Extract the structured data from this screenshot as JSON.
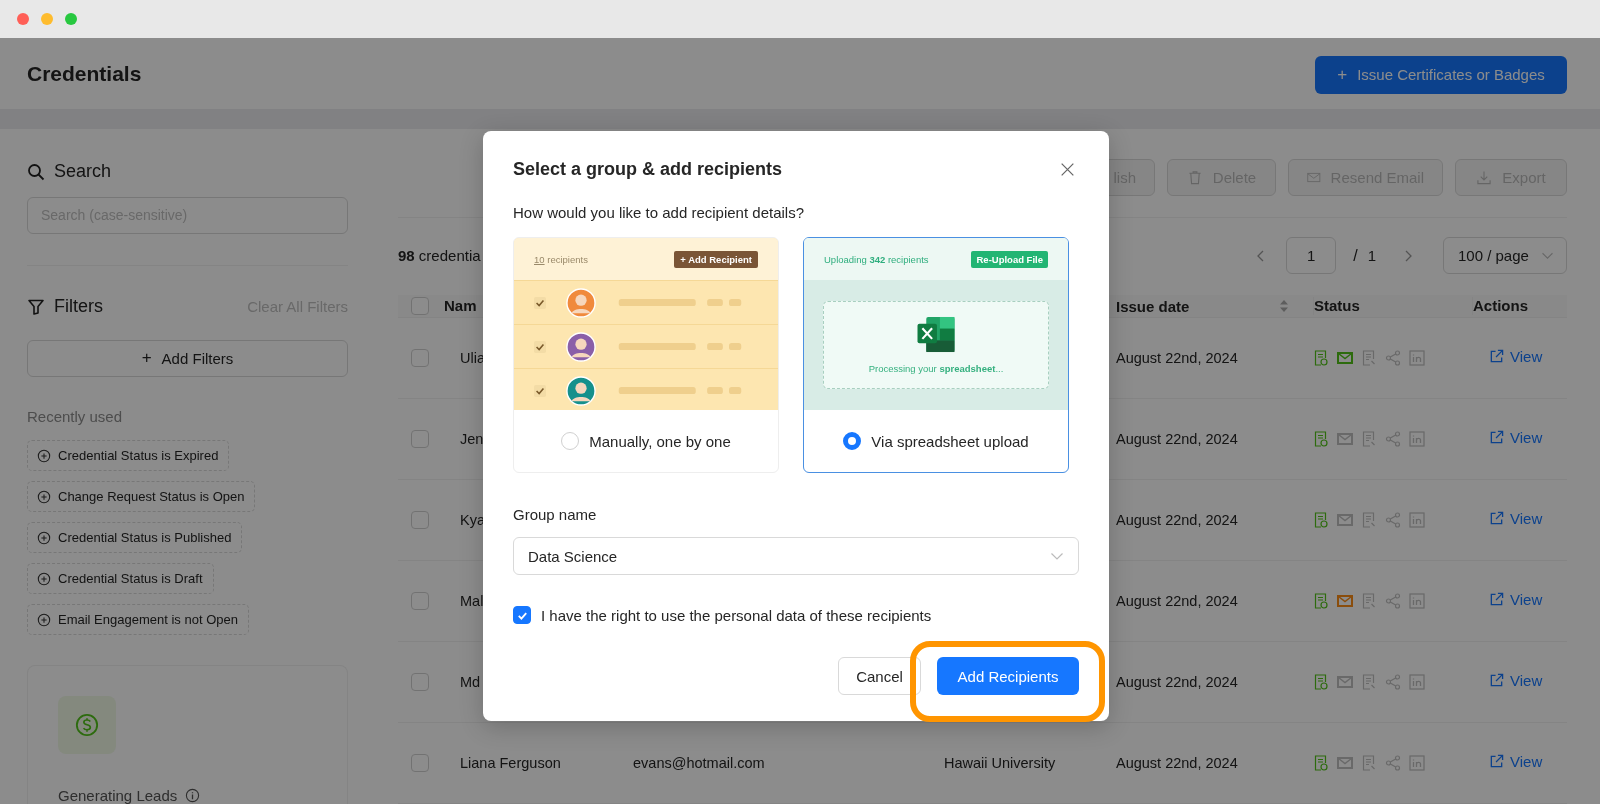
{
  "header": {
    "title": "Credentials",
    "primary_button": {
      "icon": "+",
      "label": "Issue Certificates or Badges"
    }
  },
  "sidebar": {
    "search": {
      "heading": "Search",
      "placeholder": "Search (case-sensitive)"
    },
    "filters": {
      "heading": "Filters",
      "clear_link": "Clear All Filters",
      "add_button": {
        "icon": "+",
        "label": "Add Filters"
      }
    },
    "recently_used": {
      "heading": "Recently used",
      "chips": [
        "Credential Status is Expired",
        "Change Request Status is Open",
        "Credential Status is Published",
        "Credential Status is Draft",
        "Email Engagement is not Open"
      ]
    },
    "card": {
      "title": "Generating Leads"
    }
  },
  "toolbar": {
    "buttons": [
      {
        "kind": "publish",
        "label": "lish",
        "disabled": true
      },
      {
        "kind": "delete",
        "label": "Delete",
        "disabled": true
      },
      {
        "kind": "resend",
        "label": "Resend Email",
        "disabled": true
      },
      {
        "kind": "export",
        "label": "Export",
        "disabled": true
      }
    ]
  },
  "summary": {
    "count": "98",
    "label": "credentia"
  },
  "pagination": {
    "page": "1",
    "separator": "/",
    "total": "1",
    "page_size": "100 / page"
  },
  "table": {
    "select_all": {
      "checked": false
    },
    "columns": {
      "name": "Nam",
      "issue_date": "Issue date",
      "status": "Status",
      "actions": "Actions"
    },
    "rows": [
      {
        "selected": false,
        "name": "Ulia",
        "issue_date": "August 22nd, 2024",
        "action": "View",
        "status": [
          {
            "kind": "certificate",
            "color": "#2d6c0e"
          },
          {
            "kind": "mail",
            "color": "#2d6c0e"
          },
          {
            "kind": "document",
            "color": "#696969"
          },
          {
            "kind": "share",
            "color": "#696969"
          },
          {
            "kind": "linkedin",
            "color": "#696969"
          }
        ]
      },
      {
        "selected": false,
        "name": "Jen",
        "issue_date": "August 22nd, 2024",
        "action": "View",
        "status": [
          {
            "kind": "certificate",
            "color": "#2d6c0e"
          },
          {
            "kind": "mail",
            "color": "#696969"
          },
          {
            "kind": "document",
            "color": "#696969"
          },
          {
            "kind": "share",
            "color": "#696969"
          },
          {
            "kind": "linkedin",
            "color": "#696969"
          }
        ]
      },
      {
        "selected": false,
        "name": "Kya",
        "issue_date": "August 22nd, 2024",
        "action": "View",
        "status": [
          {
            "kind": "certificate",
            "color": "#2d6c0e"
          },
          {
            "kind": "mail",
            "color": "#696969"
          },
          {
            "kind": "document",
            "color": "#696969"
          },
          {
            "kind": "share",
            "color": "#696969"
          },
          {
            "kind": "linkedin",
            "color": "#696969"
          }
        ]
      },
      {
        "selected": false,
        "name": "Mal",
        "issue_date": "August 22nd, 2024",
        "action": "View",
        "status": [
          {
            "kind": "certificate",
            "color": "#2d6c0e"
          },
          {
            "kind": "mail",
            "color": "#8a4d0c"
          },
          {
            "kind": "document",
            "color": "#696969"
          },
          {
            "kind": "share",
            "color": "#696969"
          },
          {
            "kind": "linkedin",
            "color": "#696969"
          }
        ]
      },
      {
        "selected": false,
        "name": "Md",
        "issue_date": "August 22nd, 2024",
        "action": "View",
        "status": [
          {
            "kind": "certificate",
            "color": "#2d6c0e"
          },
          {
            "kind": "mail",
            "color": "#696969"
          },
          {
            "kind": "document",
            "color": "#696969"
          },
          {
            "kind": "share",
            "color": "#696969"
          },
          {
            "kind": "linkedin",
            "color": "#696969"
          }
        ]
      },
      {
        "selected": false,
        "name": "Liana Ferguson",
        "email": "evans@hotmail.com",
        "university": "Hawaii University",
        "issue_date": "August 22nd, 2024",
        "action": "View",
        "status": [
          {
            "kind": "certificate",
            "color": "#2d6c0e"
          },
          {
            "kind": "mail",
            "color": "#696969"
          },
          {
            "kind": "document",
            "color": "#696969"
          },
          {
            "kind": "share",
            "color": "#696969"
          },
          {
            "kind": "linkedin",
            "color": "#696969"
          }
        ]
      }
    ]
  },
  "modal": {
    "title": "Select a group & add recipients",
    "question": "How would you like to add recipient details?",
    "options": [
      {
        "kind": "manual",
        "label": "Manually, one by one",
        "selected": false,
        "preview": {
          "count": "10",
          "count_label": "recipients",
          "button": "+ Add Recipient",
          "rows": [
            {
              "checked": true,
              "color": "#f08a3c"
            },
            {
              "checked": true,
              "color": "#8a5fa8"
            },
            {
              "checked": true,
              "color": "#15908c"
            }
          ]
        }
      },
      {
        "kind": "spreadsheet",
        "label": "Via spreadsheet upload",
        "selected": true,
        "preview": {
          "status": "Uploading **342** recipients",
          "button": "Re-Upload File",
          "processing": "Processing your **spreadsheet**..."
        }
      }
    ],
    "group": {
      "label": "Group name",
      "value": "Data Science"
    },
    "consent": {
      "label": "I have the right to use the personal data of these recipients",
      "checked": true
    },
    "buttons": {
      "cancel": "Cancel",
      "submit": "Add Recipients"
    }
  }
}
